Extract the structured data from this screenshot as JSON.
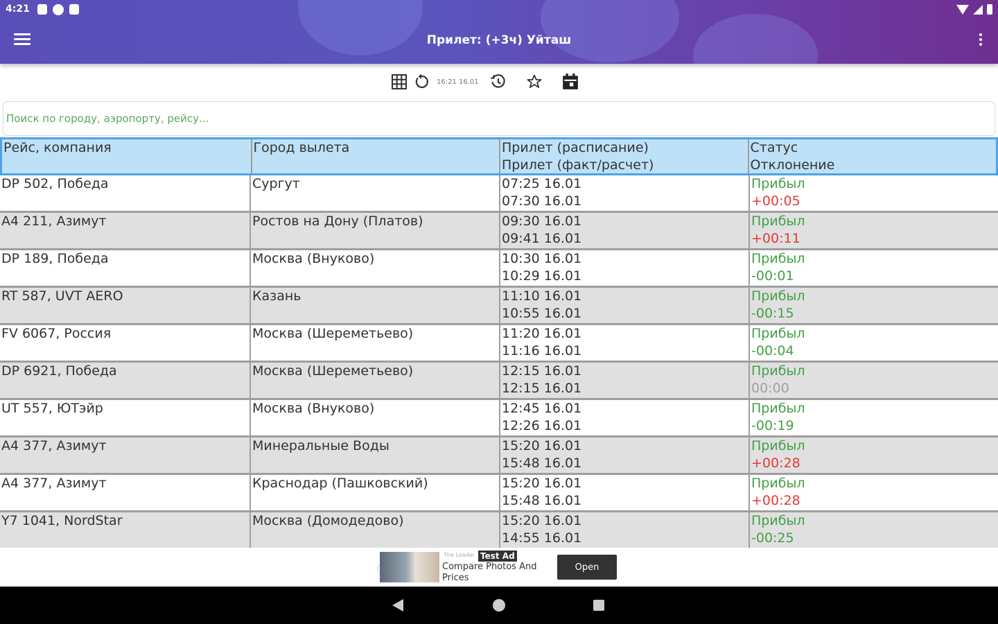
{
  "statusbar": {
    "time": "4:21"
  },
  "appbar": {
    "title": "Прилет: (+3ч) Уйташ"
  },
  "toolbar": {
    "updated": "16:21 16.01"
  },
  "search": {
    "placeholder": "Поиск по городу, аэропорту, рейсу..."
  },
  "table": {
    "headers": [
      "Рейс, компания",
      "Город вылета",
      "Прилет (расписание)",
      "Прилет (факт/расчет)",
      "Статус",
      "Отклонение"
    ],
    "rows": [
      {
        "flight": "DP 502, Победа",
        "city": "Сургут",
        "sched": "07:25 16.01",
        "actual": "07:30 16.01",
        "status": "Прибыл",
        "deviation": "+00:05"
      },
      {
        "flight": "A4 211, Азимут",
        "city": "Ростов на Дону (Платов)",
        "sched": "09:30 16.01",
        "actual": "09:41 16.01",
        "status": "Прибыл",
        "deviation": "+00:11"
      },
      {
        "flight": "DP 189, Победа",
        "city": "Москва (Внуково)",
        "sched": "10:30 16.01",
        "actual": "10:29 16.01",
        "status": "Прибыл",
        "deviation": "-00:01"
      },
      {
        "flight": "RT 587, UVT AERO",
        "city": "Казань",
        "sched": "11:10 16.01",
        "actual": "10:55 16.01",
        "status": "Прибыл",
        "deviation": "-00:15"
      },
      {
        "flight": "FV 6067, Россия",
        "city": "Москва (Шереметьево)",
        "sched": "11:20 16.01",
        "actual": "11:16 16.01",
        "status": "Прибыл",
        "deviation": "-00:04"
      },
      {
        "flight": "DP 6921, Победа",
        "city": "Москва (Шереметьево)",
        "sched": "12:15 16.01",
        "actual": "12:15 16.01",
        "status": "Прибыл",
        "deviation": "00:00"
      },
      {
        "flight": "UT 557, ЮТэйр",
        "city": "Москва (Внуково)",
        "sched": "12:45 16.01",
        "actual": "12:26 16.01",
        "status": "Прибыл",
        "deviation": "-00:19"
      },
      {
        "flight": "A4 377, Азимут",
        "city": "Минеральные Воды",
        "sched": "15:20 16.01",
        "actual": "15:48 16.01",
        "status": "Прибыл",
        "deviation": "+00:28"
      },
      {
        "flight": "A4 377, Азимут",
        "city": "Краснодар (Пашковский)",
        "sched": "15:20 16.01",
        "actual": "15:48 16.01",
        "status": "Прибыл",
        "deviation": "+00:28"
      },
      {
        "flight": "Y7 1041, NordStar",
        "city": "Москва (Домодедово)",
        "sched": "15:20 16.01",
        "actual": "14:55 16.01",
        "status": "Прибыл",
        "deviation": "-00:25"
      }
    ]
  },
  "ad": {
    "badge": "Test Ad",
    "advertiser": "The Leader",
    "text": "Compare Photos And Prices",
    "button": "Open"
  },
  "icons": {
    "menu": "hamburger-menu-icon",
    "more": "overflow-menu-icon",
    "table": "grid-icon",
    "refresh": "refresh-icon",
    "history": "history-icon",
    "favorites": "star-icon",
    "calendar": "calendar-icon"
  },
  "colors": {
    "header_start": "#5a4fb8",
    "header_end": "#6f2f92",
    "table_header_bg": "#bfe1f8",
    "table_header_border": "#4aa3e8",
    "status_green": "#43a047",
    "deviation_red": "#e53935",
    "deviation_zero": "#a0a0a0"
  }
}
